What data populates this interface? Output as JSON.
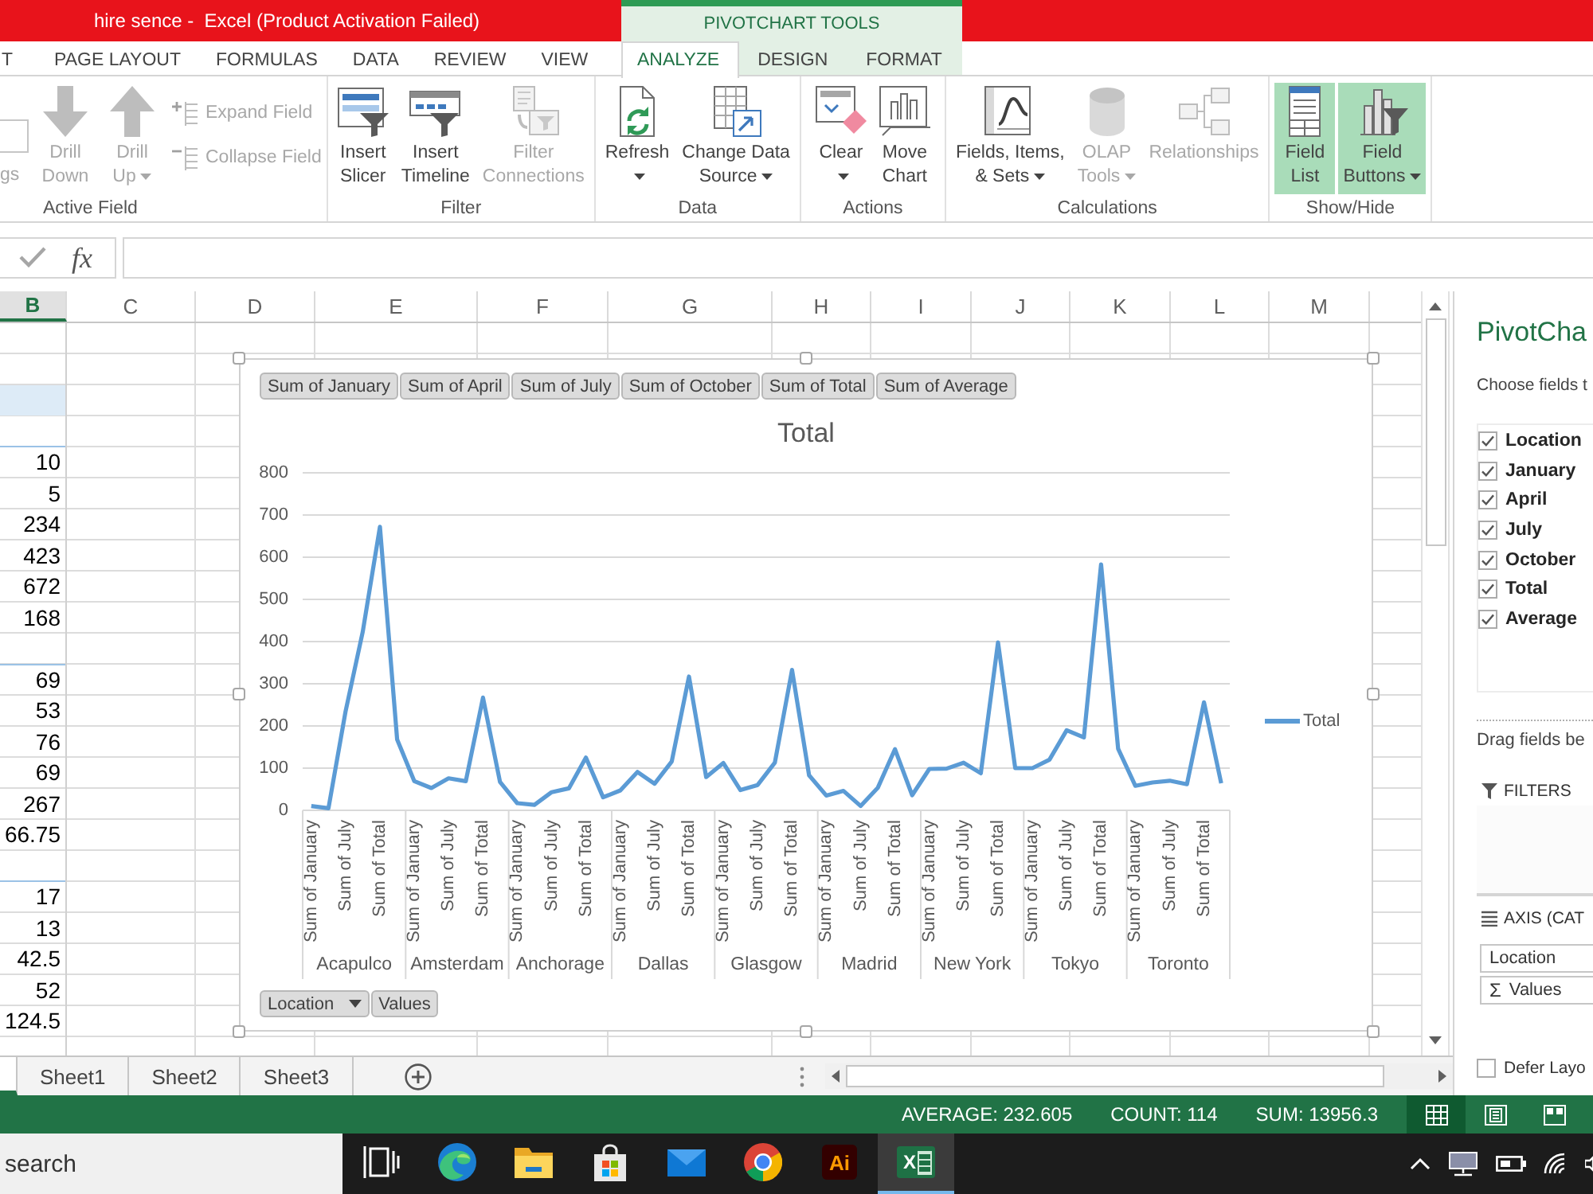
{
  "window": {
    "title": "hire sence -  Excel (Product Activation Failed)"
  },
  "tabs": [
    {
      "label": "T",
      "selected": false
    },
    {
      "label": "PAGE LAYOUT",
      "selected": false
    },
    {
      "label": "FORMULAS",
      "selected": false
    },
    {
      "label": "DATA",
      "selected": false
    },
    {
      "label": "REVIEW",
      "selected": false
    },
    {
      "label": "VIEW",
      "selected": false
    }
  ],
  "context_tabs": {
    "label": "PIVOTCHART TOOLS",
    "tabs": [
      {
        "label": "ANALYZE",
        "selected": true
      },
      {
        "label": "DESIGN",
        "selected": false
      },
      {
        "label": "FORMAT",
        "selected": false
      }
    ]
  },
  "ribbon": {
    "groups": [
      {
        "label": "Active Field",
        "commands": [
          {
            "kind": "field",
            "label": "gs",
            "disabled": true,
            "selected": false,
            "menu": false
          },
          {
            "kind": "large",
            "label": "Drill\nDown",
            "disabled": true,
            "selected": false,
            "menu": false
          },
          {
            "kind": "large",
            "label": "Drill\nUp",
            "disabled": true,
            "selected": false,
            "menu": true
          },
          {
            "kind": "small",
            "label": "Expand Field",
            "disabled": true,
            "selected": false,
            "menu": false
          },
          {
            "kind": "small",
            "label": "Collapse Field",
            "disabled": true,
            "selected": false,
            "menu": false
          }
        ]
      },
      {
        "label": "Filter",
        "commands": [
          {
            "kind": "large",
            "label": "Insert\nSlicer",
            "disabled": false,
            "selected": false,
            "menu": false
          },
          {
            "kind": "large",
            "label": "Insert\nTimeline",
            "disabled": false,
            "selected": false,
            "menu": false
          },
          {
            "kind": "large",
            "label": "Filter\nConnections",
            "disabled": true,
            "selected": false,
            "menu": false
          }
        ]
      },
      {
        "label": "Data",
        "commands": [
          {
            "kind": "large",
            "label": "Refresh",
            "disabled": false,
            "selected": false,
            "menu": true
          },
          {
            "kind": "large",
            "label": "Change Data\nSource",
            "disabled": false,
            "selected": false,
            "menu": true
          }
        ]
      },
      {
        "label": "Actions",
        "commands": [
          {
            "kind": "large",
            "label": "Clear",
            "disabled": false,
            "selected": false,
            "menu": true
          },
          {
            "kind": "large",
            "label": "Move\nChart",
            "disabled": false,
            "selected": false,
            "menu": false
          }
        ]
      },
      {
        "label": "Calculations",
        "commands": [
          {
            "kind": "large",
            "label": "Fields, Items,\n& Sets",
            "disabled": false,
            "selected": false,
            "menu": true
          },
          {
            "kind": "large",
            "label": "OLAP\nTools",
            "disabled": true,
            "selected": false,
            "menu": true
          },
          {
            "kind": "large",
            "label": "Relationships",
            "disabled": true,
            "selected": false,
            "menu": false
          }
        ]
      },
      {
        "label": "Show/Hide",
        "commands": [
          {
            "kind": "large",
            "label": "Field\nList",
            "disabled": false,
            "selected": true,
            "menu": false
          },
          {
            "kind": "large",
            "label": "Field\nButtons",
            "disabled": false,
            "selected": true,
            "menu": true
          }
        ]
      }
    ]
  },
  "formula_bar": {
    "function_label": "fx"
  },
  "sheet": {
    "columns": [
      {
        "label": "B",
        "selected": true
      },
      {
        "label": "C",
        "selected": false
      },
      {
        "label": "D",
        "selected": false
      },
      {
        "label": "E",
        "selected": false
      },
      {
        "label": "F",
        "selected": false
      },
      {
        "label": "G",
        "selected": false
      },
      {
        "label": "H",
        "selected": false
      },
      {
        "label": "I",
        "selected": false
      },
      {
        "label": "J",
        "selected": false
      },
      {
        "label": "K",
        "selected": false
      },
      {
        "label": "L",
        "selected": false
      },
      {
        "label": "M",
        "selected": false
      }
    ],
    "rows": [
      {
        "kind": "blank"
      },
      {
        "kind": "blank"
      },
      {
        "kind": "header"
      },
      {
        "kind": "separator"
      },
      {
        "kind": "value",
        "value": "10"
      },
      {
        "kind": "value",
        "value": "5"
      },
      {
        "kind": "value",
        "value": "234"
      },
      {
        "kind": "value",
        "value": "423"
      },
      {
        "kind": "value",
        "value": "672"
      },
      {
        "kind": "value",
        "value": "168"
      },
      {
        "kind": "separator"
      },
      {
        "kind": "value",
        "value": "69"
      },
      {
        "kind": "value",
        "value": "53"
      },
      {
        "kind": "value",
        "value": "76"
      },
      {
        "kind": "value",
        "value": "69"
      },
      {
        "kind": "value",
        "value": "267"
      },
      {
        "kind": "value",
        "value": "66.75"
      },
      {
        "kind": "separator"
      },
      {
        "kind": "value",
        "value": "17"
      },
      {
        "kind": "value",
        "value": "13"
      },
      {
        "kind": "value",
        "value": "42.5"
      },
      {
        "kind": "value",
        "value": "52"
      },
      {
        "kind": "value",
        "value": "124.5"
      }
    ]
  },
  "chart": {
    "field_buttons": [
      "Sum of January",
      "Sum of April",
      "Sum of July",
      "Sum of October",
      "Sum of Total",
      "Sum of Average"
    ],
    "axis_buttons": [
      {
        "label": "Location",
        "menu": true
      },
      {
        "label": "Values",
        "menu": false
      }
    ],
    "category_groups": [
      "Acapulco",
      "Amsterdam",
      "Anchorage",
      "Dallas",
      "Glasgow",
      "Madrid",
      "New York",
      "Tokyo",
      "Toronto"
    ],
    "chart_data": {
      "type": "line",
      "title": "Total",
      "grid": true,
      "ylim": [
        0,
        800
      ],
      "yticks": [
        0,
        100,
        200,
        300,
        400,
        500,
        600,
        700,
        800
      ],
      "categories": [
        "Sum of January",
        null,
        "Sum of July",
        null,
        "Sum of Total",
        null,
        "Sum of January",
        null,
        "Sum of July",
        null,
        "Sum of Total",
        null,
        "Sum of January",
        null,
        "Sum of July",
        null,
        "Sum of Total",
        null,
        "Sum of January",
        null,
        "Sum of July",
        null,
        "Sum of Total",
        null,
        "Sum of January",
        null,
        "Sum of July",
        null,
        "Sum of Total",
        null,
        "Sum of January",
        null,
        "Sum of July",
        null,
        "Sum of Total",
        null,
        "Sum of January",
        null,
        "Sum of July",
        null,
        "Sum of Total",
        null,
        "Sum of January",
        null,
        "Sum of July",
        null,
        "Sum of Total",
        null,
        "Sum of January",
        null,
        "Sum of July",
        null,
        "Sum of Total",
        null
      ],
      "series": [
        {
          "name": "Total",
          "color": "#5b9bd5",
          "values": [
            10,
            5,
            234,
            423,
            672,
            168,
            69,
            53,
            76,
            69,
            267,
            67,
            17,
            13,
            43,
            52,
            125,
            31,
            47,
            91,
            63,
            116,
            317,
            79,
            112,
            48,
            60,
            113,
            333,
            83,
            35,
            46,
            10,
            54,
            145,
            36,
            98,
            99,
            113,
            88,
            398,
            100,
            100,
            120,
            190,
            173,
            583,
            146,
            58,
            66,
            70,
            62,
            256,
            64
          ]
        }
      ]
    }
  },
  "pane": {
    "title": "PivotCha",
    "subtitle": "Choose fields t",
    "fields": [
      {
        "label": "Location",
        "checked": true
      },
      {
        "label": "January",
        "checked": true
      },
      {
        "label": "April",
        "checked": true
      },
      {
        "label": "July",
        "checked": true
      },
      {
        "label": "October",
        "checked": true
      },
      {
        "label": "Total",
        "checked": true
      },
      {
        "label": "Average",
        "checked": true
      }
    ],
    "hint": "Drag fields be",
    "areas": [
      {
        "kind": "filters",
        "label": "FILTERS"
      },
      {
        "kind": "axis",
        "label": "AXIS (CAT",
        "items": [
          {
            "label": "Location"
          },
          {
            "label": "Values",
            "symbol": "Σ"
          }
        ]
      }
    ],
    "defer": {
      "label": "Defer Layo",
      "checked": false
    }
  },
  "sheet_tabs": [
    {
      "selected": true
    },
    {
      "label": "Sheet1",
      "selected": false
    },
    {
      "label": "Sheet2",
      "selected": false
    },
    {
      "label": "Sheet3",
      "selected": false
    }
  ],
  "status_bar": {
    "stats": [
      "AVERAGE: 232.605",
      "COUNT: 114",
      "SUM: 13956.3"
    ],
    "views": [
      {
        "kind": "normal",
        "selected": true
      },
      {
        "kind": "page-layout",
        "selected": false
      },
      {
        "kind": "page-break",
        "selected": false
      }
    ]
  },
  "taskbar": {
    "search": {
      "placeholder": "search"
    },
    "apps": [
      {
        "kind": "task-view",
        "selected": false
      },
      {
        "kind": "edge",
        "selected": false
      },
      {
        "kind": "folder",
        "selected": false
      },
      {
        "kind": "store",
        "selected": false
      },
      {
        "kind": "mail",
        "selected": false
      },
      {
        "kind": "chrome",
        "selected": false
      },
      {
        "kind": "ai",
        "label": "Ai",
        "selected": false
      },
      {
        "kind": "excel",
        "label": "X",
        "selected": true
      }
    ]
  }
}
